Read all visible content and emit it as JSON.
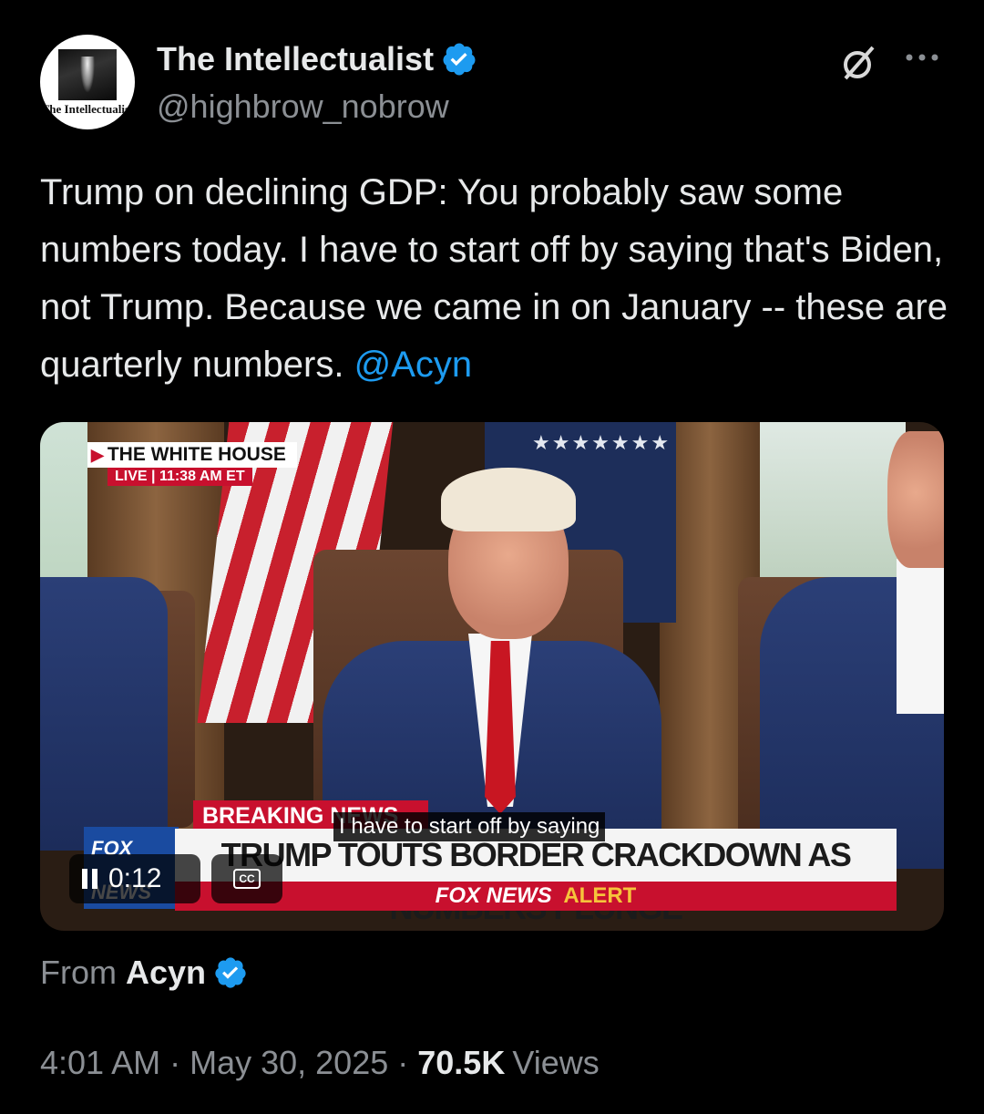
{
  "author": {
    "display_name": "The Intellectualist",
    "handle": "@highbrow_nobrow",
    "avatar_wordmark": "The Intellectualist",
    "verified": true
  },
  "header_icons": {
    "grok": "grok-icon",
    "more": "more-icon"
  },
  "tweet": {
    "text": "Trump on declining GDP: You probably saw some numbers today. I have to start off by saying that's Biden, not Trump. Because we came in on January -- these are quarterly numbers.",
    "mention": "@Acyn"
  },
  "video": {
    "live_title": "THE WHITE HOUSE",
    "live_label": "LIVE",
    "live_time": "11:38 AM ET",
    "breaking_label": "BREAKING NEWS",
    "headline": "TRUMP TOUTS BORDER CRACKDOWN AS NUMBERS PLUNGE",
    "alert_prefix": "FOX NEWS",
    "alert_word": "ALERT",
    "network_logo": "FOX NEWS",
    "caption": "I have to start off by saying",
    "elapsed": "0:12",
    "cc_label": "CC"
  },
  "source": {
    "from_label": "From",
    "name": "Acyn",
    "verified": true
  },
  "meta": {
    "time": "4:01 AM",
    "separator": "·",
    "date": "May 30, 2025",
    "views_count": "70.5K",
    "views_label": "Views"
  },
  "colors": {
    "background": "#000000",
    "text": "#e7e9ea",
    "secondary": "#8b8f94",
    "link": "#1d9bf0",
    "verified_badge": "#1d9bf0"
  }
}
